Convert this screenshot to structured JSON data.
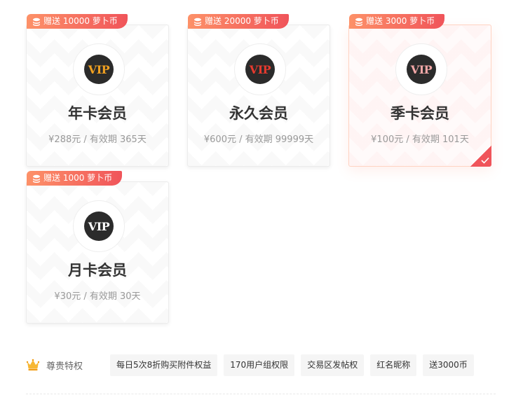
{
  "plans": [
    {
      "bonus": "赠送 10000 萝卜币",
      "vip_text": "VIP",
      "vip_color": "#f0a020",
      "title": "年卡会员",
      "price": "¥288元 / 有效期 365天",
      "selected": false
    },
    {
      "bonus": "赠送 20000 萝卜币",
      "vip_text": "VIP",
      "vip_color": "#e63a2e",
      "title": "永久会员",
      "price": "¥600元 / 有效期 99999天",
      "selected": false
    },
    {
      "bonus": "赠送 3000 萝卜币",
      "vip_text": "VIP",
      "vip_color": "#f3a7a7",
      "title": "季卡会员",
      "price": "¥100元 / 有效期 101天",
      "selected": true
    },
    {
      "bonus": "赠送 1000 萝卜币",
      "vip_text": "VIP",
      "vip_color": "#ffffff",
      "title": "月卡会员",
      "price": "¥30元 / 有效期 30天",
      "selected": false
    }
  ],
  "privileges": {
    "label": "尊贵特权",
    "icon": "crown-icon",
    "tags": [
      "每日5次8折购买附件权益",
      "170用户组权限",
      "交易区发帖权",
      "红名昵称",
      "送3000币"
    ]
  },
  "colors": {
    "ribbon_start": "#fd9168",
    "ribbon_end": "#f0545a",
    "accent": "#f0545a"
  }
}
